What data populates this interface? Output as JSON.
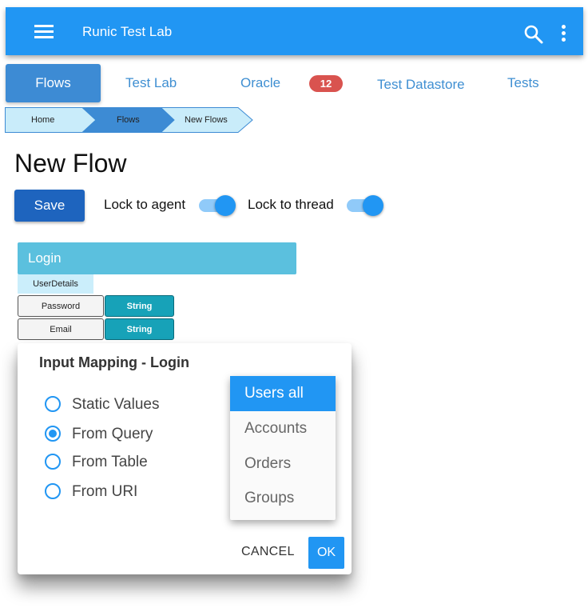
{
  "app": {
    "title": "Runic Test Lab"
  },
  "icons": {
    "menu": "hamburger-menu-icon",
    "search": "search-icon",
    "more": "more-vert-icon"
  },
  "colors": {
    "primary": "#2196f3",
    "active_tab": "#3d8bd4",
    "badge": "#d9534f",
    "node_header": "#5bc0de",
    "type_cell": "#17a2b8",
    "save": "#1e64be"
  },
  "tabs": [
    {
      "label": "Flows",
      "active": true
    },
    {
      "label": "Test Lab"
    },
    {
      "label": "Oracle",
      "badge": "12"
    },
    {
      "label": "Test Datastore"
    },
    {
      "label": "Tests"
    }
  ],
  "breadcrumb": [
    "Home",
    "Flows",
    "New Flows"
  ],
  "page": {
    "title": "New Flow"
  },
  "toolbar": {
    "save_label": "Save",
    "lock_agent_label": "Lock to agent",
    "lock_agent_on": true,
    "lock_thread_label": "Lock to thread",
    "lock_thread_on": true
  },
  "node": {
    "title": "Login",
    "group": "UserDetails",
    "fields": [
      {
        "name": "Password",
        "type": "String"
      },
      {
        "name": "Email",
        "type": "String"
      }
    ]
  },
  "dialog": {
    "title": "Input Mapping - Login",
    "options": [
      "Static Values",
      "From Query",
      "From Table",
      "From URI"
    ],
    "selected_option": "From Query",
    "cancel_label": "CANCEL",
    "ok_label": "OK"
  },
  "query_menu": {
    "items": [
      "Users all",
      "Accounts",
      "Orders",
      "Groups"
    ],
    "selected": "Users all"
  }
}
